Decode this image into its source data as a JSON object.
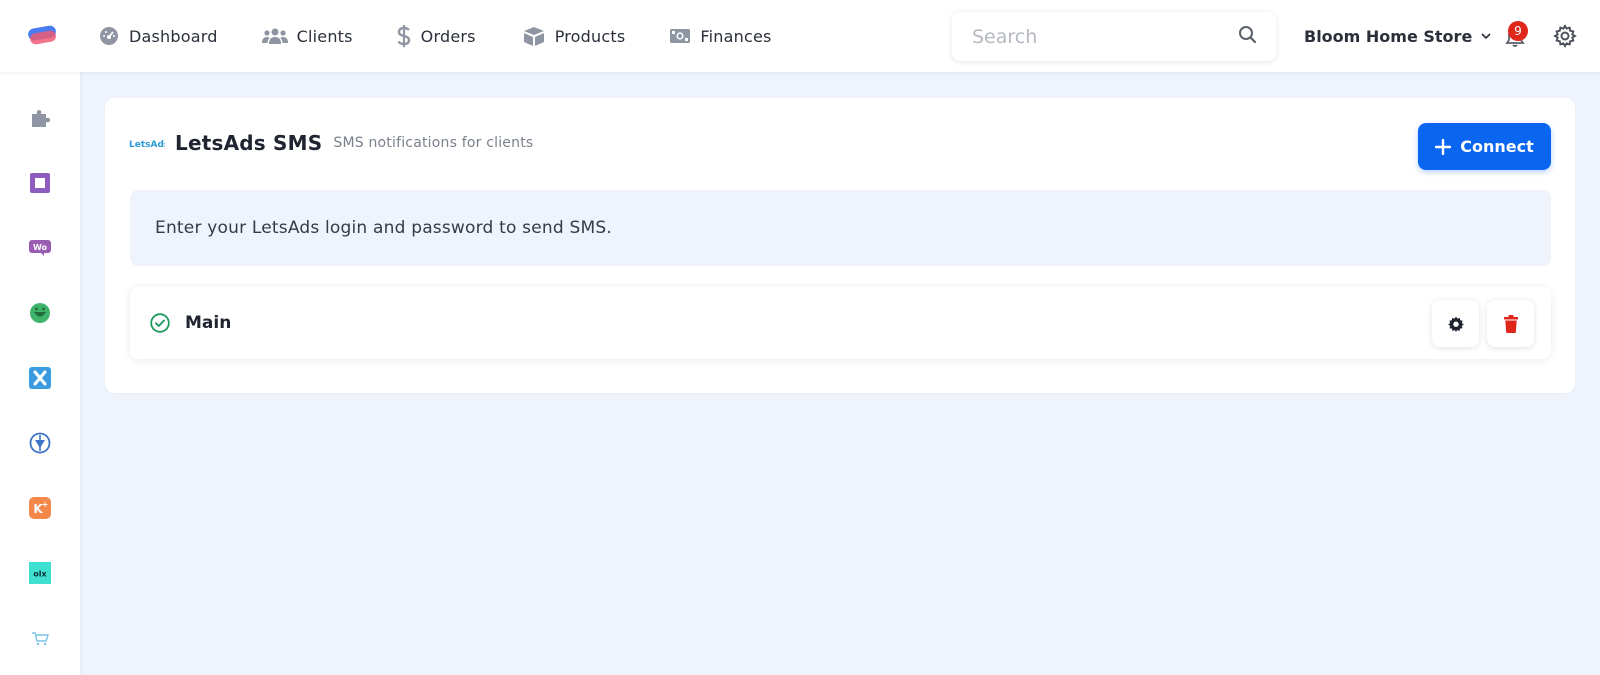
{
  "nav": {
    "items": [
      {
        "label": "Dashboard",
        "icon": "dashboard-icon"
      },
      {
        "label": "Clients",
        "icon": "users-icon"
      },
      {
        "label": "Orders",
        "icon": "dollar-icon"
      },
      {
        "label": "Products",
        "icon": "box-icon"
      },
      {
        "label": "Finances",
        "icon": "money-icon"
      }
    ]
  },
  "search": {
    "placeholder": "Search"
  },
  "store": {
    "name": "Bloom Home Store"
  },
  "notifications": {
    "count": "9"
  },
  "sidebar": {
    "items": [
      {
        "icon": "puzzle-icon"
      },
      {
        "icon": "square-app-icon"
      },
      {
        "icon": "woo-icon"
      },
      {
        "icon": "smile-app-icon"
      },
      {
        "icon": "x-app-icon"
      },
      {
        "icon": "pin-app-icon"
      },
      {
        "icon": "k-plus-icon"
      },
      {
        "icon": "olx-icon"
      },
      {
        "icon": "cart-icon"
      }
    ]
  },
  "integration": {
    "brand_logo_text": "LetsAds",
    "title": "LetsAds SMS",
    "subtitle": "SMS notifications for clients",
    "connect_label": "Connect",
    "info_text": "Enter your LetsAds login and password to send SMS.",
    "connections": [
      {
        "name": "Main",
        "status": "connected"
      }
    ]
  },
  "colors": {
    "accent": "#0a66f0",
    "danger": "#e0261b",
    "success": "#1a9a5c",
    "page_bg": "#eff3fb"
  }
}
